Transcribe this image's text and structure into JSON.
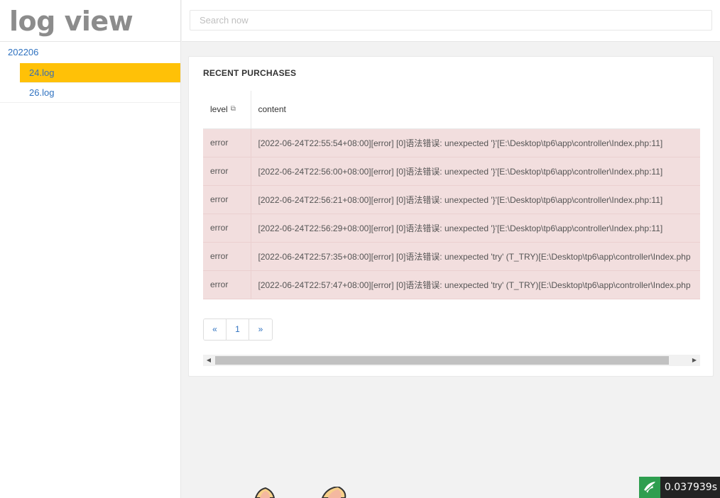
{
  "brand": {
    "title": "log view"
  },
  "search": {
    "placeholder": "Search now",
    "value": ""
  },
  "sidebar": {
    "folder": "202206",
    "files": [
      {
        "label": "24.log",
        "active": true
      },
      {
        "label": "26.log",
        "active": false
      }
    ]
  },
  "card": {
    "title": "RECENT PURCHASES",
    "columns": {
      "level": "level",
      "content": "content"
    },
    "rows": [
      {
        "level": "error",
        "content": "[2022-06-24T22:55:54+08:00][error] [0]语法错误: unexpected '}'[E:\\Desktop\\tp6\\app\\controller\\Index.php:11]"
      },
      {
        "level": "error",
        "content": "[2022-06-24T22:56:00+08:00][error] [0]语法错误: unexpected '}'[E:\\Desktop\\tp6\\app\\controller\\Index.php:11]"
      },
      {
        "level": "error",
        "content": "[2022-06-24T22:56:21+08:00][error] [0]语法错误: unexpected '}'[E:\\Desktop\\tp6\\app\\controller\\Index.php:11]"
      },
      {
        "level": "error",
        "content": "[2022-06-24T22:56:29+08:00][error] [0]语法错误: unexpected '}'[E:\\Desktop\\tp6\\app\\controller\\Index.php:11]"
      },
      {
        "level": "error",
        "content": "[2022-06-24T22:57:35+08:00][error] [0]语法错误: unexpected 'try' (T_TRY)[E:\\Desktop\\tp6\\app\\controller\\Index.php"
      },
      {
        "level": "error",
        "content": "[2022-06-24T22:57:47+08:00][error] [0]语法错误: unexpected 'try' (T_TRY)[E:\\Desktop\\tp6\\app\\controller\\Index.php"
      }
    ],
    "pagination": {
      "prev": "«",
      "current": "1",
      "next": "»"
    }
  },
  "timer": {
    "value": "0.037939s"
  },
  "colors": {
    "accent": "#ffc107",
    "link": "#2f72c0",
    "error_row": "#f2dede",
    "timer_logo": "#2e9e4f"
  },
  "icons": {
    "sort": "sort-icon",
    "scroll_left": "arrow-left-icon",
    "scroll_right": "arrow-right-icon",
    "timer_logo": "thinkphp-logo-icon"
  }
}
